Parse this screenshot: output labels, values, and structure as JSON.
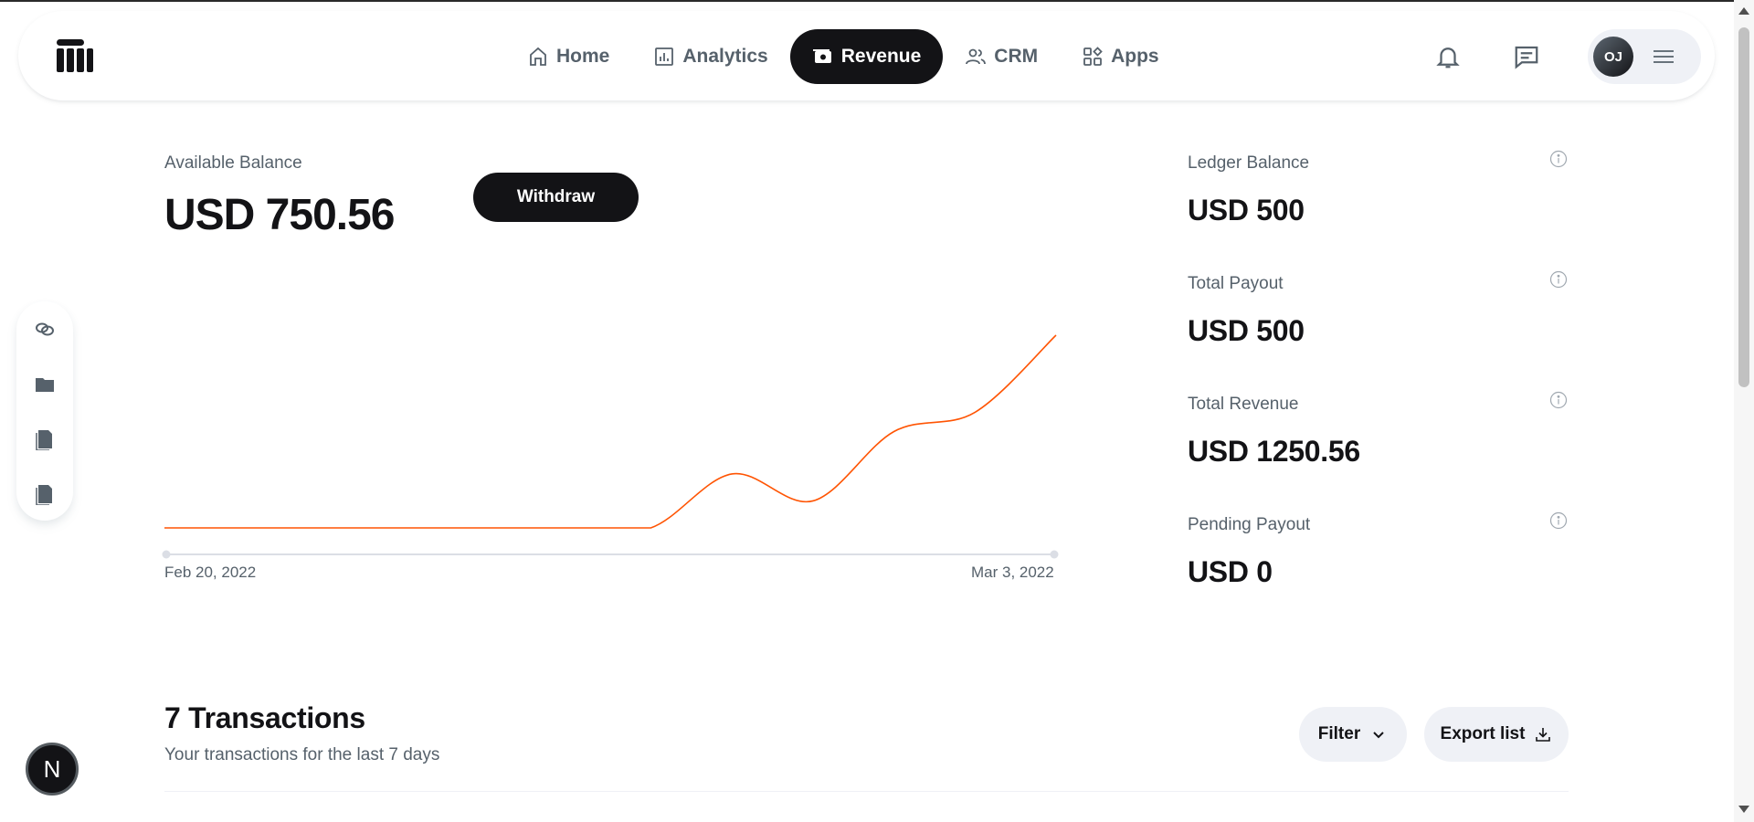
{
  "nav": {
    "items": [
      {
        "label": "Home",
        "icon": "home-icon"
      },
      {
        "label": "Analytics",
        "icon": "analytics-icon"
      },
      {
        "label": "Revenue",
        "icon": "revenue-icon",
        "active": true
      },
      {
        "label": "CRM",
        "icon": "users-icon"
      },
      {
        "label": "Apps",
        "icon": "apps-icon"
      }
    ]
  },
  "header": {
    "avatar_initials": "OJ",
    "icons": [
      "bell-icon",
      "chat-icon",
      "menu-icon"
    ]
  },
  "side_tools": [
    "link-icon",
    "folder-icon",
    "document-icon",
    "document-icon"
  ],
  "balance": {
    "available_label": "Available Balance",
    "available_value": "USD 750.56",
    "withdraw_label": "Withdraw"
  },
  "chart_data": {
    "type": "line",
    "x_start_label": "Feb 20, 2022",
    "x_end_label": "Mar 3, 2022",
    "line_color": "#ff5403",
    "values": [
      0,
      0,
      0,
      0,
      0,
      0,
      0,
      0.28,
      0.14,
      0.5,
      0.6,
      1.0
    ]
  },
  "stats": [
    {
      "label": "Ledger Balance",
      "value": "USD 500"
    },
    {
      "label": "Total Payout",
      "value": "USD 500"
    },
    {
      "label": "Total Revenue",
      "value": "USD 1250.56"
    },
    {
      "label": "Pending Payout",
      "value": "USD 0"
    }
  ],
  "transactions": {
    "title": "7 Transactions",
    "subtitle": "Your transactions for the last 7 days",
    "filter_label": "Filter",
    "export_label": "Export list"
  },
  "badge": {
    "letter": "N"
  },
  "colors": {
    "primary": "#131316",
    "muted": "#56616b",
    "chart_line": "#ff5403",
    "pill_bg": "#eff1f6"
  }
}
